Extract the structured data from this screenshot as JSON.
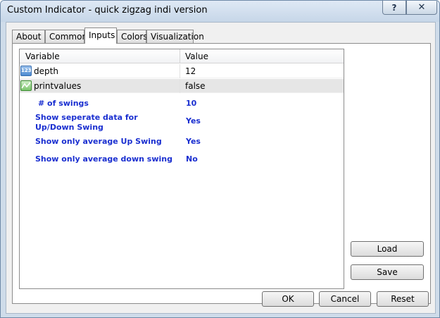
{
  "window": {
    "title": "Custom Indicator - quick zigzag indi version",
    "help_label": "?",
    "close_label": "✕"
  },
  "tabs": [
    {
      "label": "About"
    },
    {
      "label": "Common"
    },
    {
      "label": "Inputs",
      "active": true
    },
    {
      "label": "Colors"
    },
    {
      "label": "Visualization"
    }
  ],
  "grid": {
    "columns": [
      "Variable",
      "Value"
    ],
    "rows": [
      {
        "icon": "numeric-param-icon",
        "icon_text": "123",
        "variable": "depth",
        "value": "12"
      },
      {
        "icon": "boolean-param-icon",
        "variable": "printvalues",
        "value": "false",
        "selected": true
      }
    ],
    "overlay": [
      {
        "label": "# of swings",
        "value": "10"
      },
      {
        "label": "Show seperate data for Up/Down Swing",
        "value": "Yes"
      },
      {
        "label": "Show only average Up Swing",
        "value": "Yes"
      },
      {
        "label": "Show only average down swing",
        "value": "No"
      }
    ]
  },
  "side_buttons": {
    "load": "Load",
    "save": "Save"
  },
  "footer_buttons": {
    "ok": "OK",
    "cancel": "Cancel",
    "reset": "Reset"
  }
}
